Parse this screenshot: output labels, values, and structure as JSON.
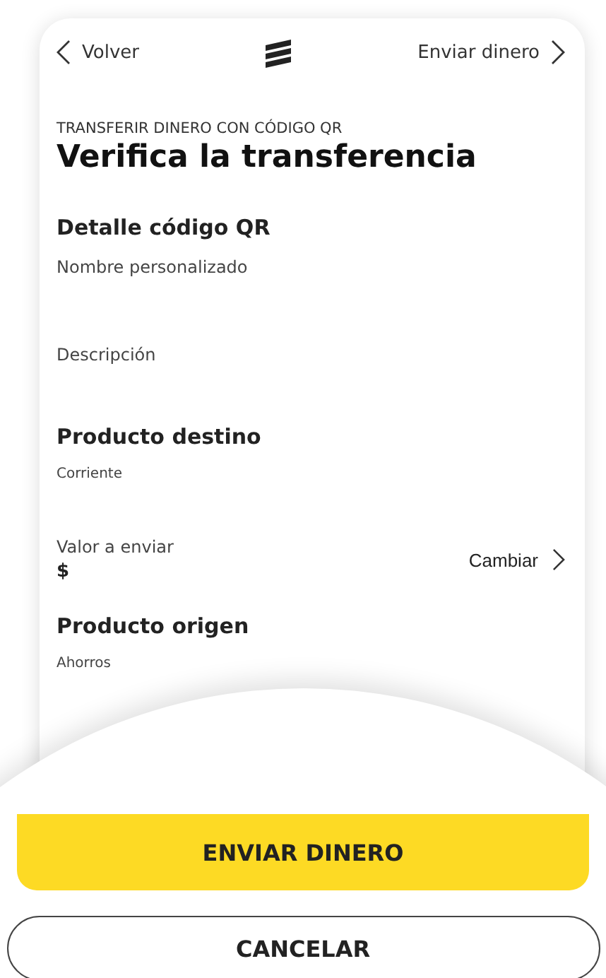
{
  "nav": {
    "back": "Volver",
    "next": "Enviar dinero"
  },
  "header": {
    "subtitle": "TRANSFERIR DINERO CON CÓDIGO QR",
    "title": "Verifica la transferencia"
  },
  "sections": [
    {
      "kind": "heading",
      "text": "Detalle código QR"
    },
    {
      "kind": "field",
      "text": "Nombre personalizado"
    },
    {
      "kind": "field",
      "text": "Descripción"
    },
    {
      "kind": "heading",
      "text": "Producto destino"
    },
    {
      "kind": "small",
      "text": "Corriente"
    },
    {
      "kind": "amount",
      "text": "Valor a enviar",
      "value": "$",
      "action": "Cambiar"
    },
    {
      "kind": "heading",
      "text": "Producto origen"
    },
    {
      "kind": "small",
      "text": "Ahorros"
    }
  ],
  "buttons": [
    {
      "kind": "primary",
      "label": "ENVIAR DINERO"
    },
    {
      "kind": "outline",
      "label": "CANCELAR"
    }
  ]
}
